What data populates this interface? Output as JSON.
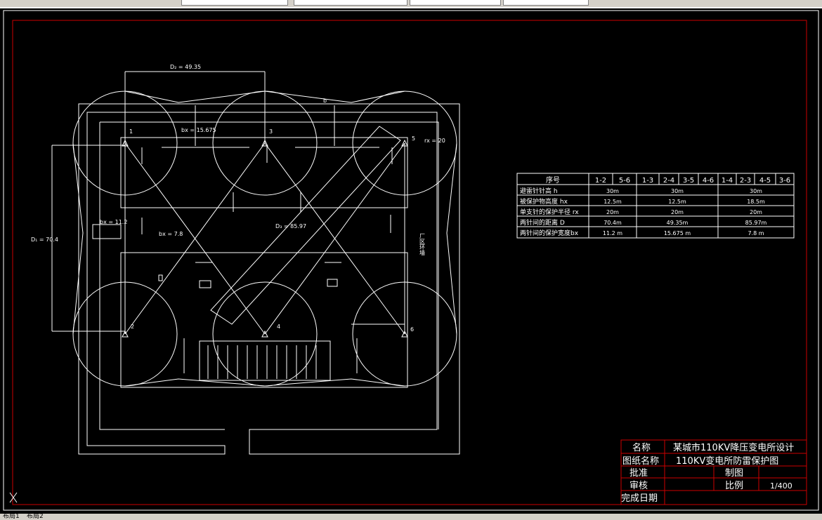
{
  "toolbar": {
    "search_placeholder": ""
  },
  "layout_tabs": [
    "布局1",
    "布局2"
  ],
  "drawing": {
    "labels": {
      "d_top": "D₂ = 49.35",
      "b_top": "b",
      "bx_top": "bx = 15.675",
      "rx": "rx = 20",
      "d_left": "D₁ = 70.4",
      "bx_left": "bx = 11.2",
      "bx_mid": "bx = 7.8",
      "d_diag": "D₃ = 85.97",
      "fence": "厂区环墙",
      "needles": [
        "1",
        "3",
        "5",
        "2",
        "4",
        "6"
      ]
    },
    "param_table": {
      "headers": [
        "序号",
        "1-2",
        "5-6",
        "1-3",
        "2-4",
        "3-5",
        "4-6",
        "1-4",
        "2-3",
        "4-5",
        "3-6"
      ],
      "rows": [
        {
          "label": "避雷针针高   h",
          "v1": "30m",
          "v2": "30m",
          "v3": "30m"
        },
        {
          "label": "被保护物高度 hx",
          "v1": "12.5m",
          "v2": "12.5m",
          "v3": "18.5m"
        },
        {
          "label": "单支针的保护半径 rx",
          "v1": "20m",
          "v2": "20m",
          "v3": "20m"
        },
        {
          "label": "两针间的距离   D",
          "v1": "70.4m",
          "v2": "49.35m",
          "v3": "85.97m"
        },
        {
          "label": "两针间的保护宽度bx",
          "v1": "11.2 m",
          "v2": "15.675 m",
          "v3": "7.8 m"
        }
      ]
    },
    "title_block": {
      "name_label": "名称",
      "name_value": "某城市110KV降压变电所设计",
      "drawing_name_label": "图纸名称",
      "drawing_name_value": "110KV变电所防雷保护图",
      "approve_label": "批准",
      "draw_label": "制图",
      "review_label": "审核",
      "scale_label": "比例",
      "scale_value": "1/400",
      "date_label": "完成日期"
    }
  },
  "colors": {
    "background": "#000000",
    "line": "#ffffff",
    "border": "#cc0000"
  }
}
